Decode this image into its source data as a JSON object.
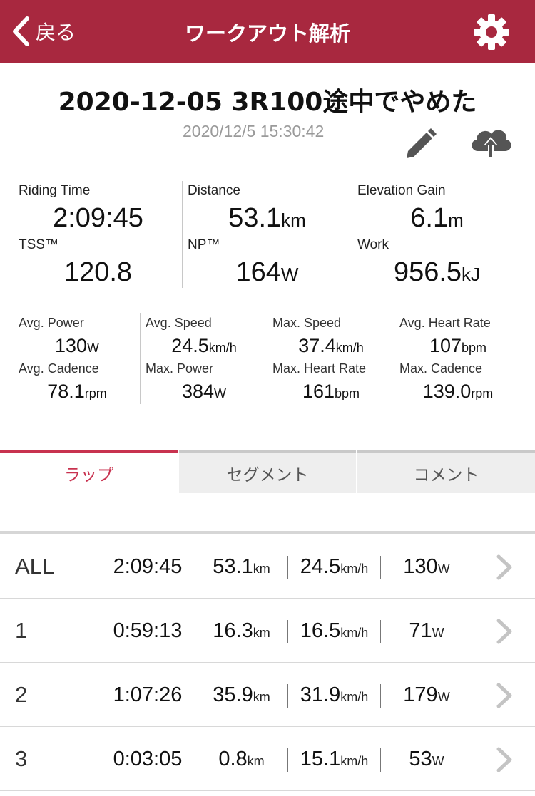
{
  "nav": {
    "back_label": "戻る",
    "title": "ワークアウト解析"
  },
  "workout": {
    "title": "2020-12-05 3R100途中でやめた",
    "datetime": "2020/12/5 15:30:42"
  },
  "icons": {
    "back": "chevron-left-icon",
    "settings": "gear-icon",
    "edit": "pencil-icon",
    "upload": "cloud-upload-icon",
    "row_action": "chevron-right-icon"
  },
  "colors": {
    "brand": "#a8283f",
    "active_tab": "#c8324f",
    "muted_text": "#9a9a9a"
  },
  "summary": [
    {
      "label": "Riding Time",
      "value": "2:09:45",
      "unit": ""
    },
    {
      "label": "Distance",
      "value": "53.1",
      "unit": "km"
    },
    {
      "label": "Elevation Gain",
      "value": "6.1",
      "unit": "m"
    },
    {
      "label": "TSS™",
      "value": "120.8",
      "unit": ""
    },
    {
      "label": "NP™",
      "value": "164",
      "unit": "W"
    },
    {
      "label": "Work",
      "value": "956.5",
      "unit": "kJ"
    }
  ],
  "details": [
    {
      "label": "Avg. Power",
      "value": "130",
      "unit": "W"
    },
    {
      "label": "Avg. Speed",
      "value": "24.5",
      "unit": "km/h"
    },
    {
      "label": "Max. Speed",
      "value": "37.4",
      "unit": "km/h"
    },
    {
      "label": "Avg. Heart Rate",
      "value": "107",
      "unit": "bpm"
    },
    {
      "label": "Avg. Cadence",
      "value": "78.1",
      "unit": "rpm"
    },
    {
      "label": "Max. Power",
      "value": "384",
      "unit": "W"
    },
    {
      "label": "Max. Heart Rate",
      "value": "161",
      "unit": "bpm"
    },
    {
      "label": "Max. Cadence",
      "value": "139.0",
      "unit": "rpm"
    }
  ],
  "tabs": [
    {
      "label": "ラップ",
      "active": true
    },
    {
      "label": "セグメント",
      "active": false
    },
    {
      "label": "コメント",
      "active": false
    }
  ],
  "laps": [
    {
      "name": "ALL",
      "time": "2:09:45",
      "distance": "53.1",
      "distance_unit": "km",
      "speed": "24.5",
      "speed_unit": "km/h",
      "power": "130",
      "power_unit": "W"
    },
    {
      "name": "1",
      "time": "0:59:13",
      "distance": "16.3",
      "distance_unit": "km",
      "speed": "16.5",
      "speed_unit": "km/h",
      "power": "71",
      "power_unit": "W"
    },
    {
      "name": "2",
      "time": "1:07:26",
      "distance": "35.9",
      "distance_unit": "km",
      "speed": "31.9",
      "speed_unit": "km/h",
      "power": "179",
      "power_unit": "W"
    },
    {
      "name": "3",
      "time": "0:03:05",
      "distance": "0.8",
      "distance_unit": "km",
      "speed": "15.1",
      "speed_unit": "km/h",
      "power": "53",
      "power_unit": "W"
    }
  ]
}
